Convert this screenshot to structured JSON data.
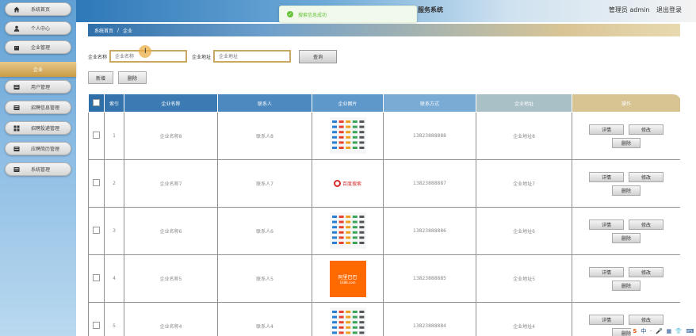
{
  "sidebar": {
    "items": [
      {
        "label": "系统首页",
        "icon": "home-icon"
      },
      {
        "label": "个人中心",
        "icon": "user-icon"
      },
      {
        "label": "企业管理",
        "icon": "building-icon"
      },
      {
        "label": "企业",
        "icon": ""
      },
      {
        "label": "用户管理",
        "icon": "list-icon"
      },
      {
        "label": "招聘信息管理",
        "icon": "list-icon"
      },
      {
        "label": "招聘投递管理",
        "icon": "grid-icon"
      },
      {
        "label": "应聘简历管理",
        "icon": "list-icon"
      },
      {
        "label": "系统管理",
        "icon": "list-icon"
      }
    ]
  },
  "header": {
    "system_title": "服务系统",
    "user_label": "管理员 admin",
    "logout_label": "退出登录"
  },
  "toast": {
    "message": "搜索信息成功"
  },
  "breadcrumb": {
    "home": "系统首页",
    "separator": "/",
    "current": "企业"
  },
  "search": {
    "company_name_label": "企业名称",
    "company_name_placeholder": "企业名称",
    "company_addr_label": "企业地址",
    "company_addr_placeholder": "企业地址",
    "search_button": "查询"
  },
  "actions": {
    "add": "新增",
    "delete": "删除"
  },
  "table": {
    "columns": [
      "",
      "索引",
      "企业名称",
      "联系人",
      "企业图片",
      "联系方式",
      "企业地址",
      "操作"
    ],
    "rows": [
      {
        "index": "1",
        "name": "企业名称8",
        "contact": "联系人8",
        "image": "logo-grid",
        "phone": "13823888888",
        "address": "企业地址8"
      },
      {
        "index": "2",
        "name": "企业名称7",
        "contact": "联系人7",
        "image": "logo-red",
        "phone": "13823888887",
        "address": "企业地址7"
      },
      {
        "index": "3",
        "name": "企业名称6",
        "contact": "联系人6",
        "image": "logo-grid",
        "phone": "13823888886",
        "address": "企业地址6"
      },
      {
        "index": "4",
        "name": "企业名称5",
        "contact": "联系人5",
        "image": "logo-alibaba",
        "phone": "13823888885",
        "address": "企业地址5"
      },
      {
        "index": "5",
        "name": "企业名称4",
        "contact": "联系人4",
        "image": "logo-grid",
        "phone": "13823888884",
        "address": "企业地址4"
      }
    ],
    "op_labels": {
      "detail": "详情",
      "edit": "修改",
      "delete": "删除"
    },
    "logo_red_text": "百度搜索",
    "logo_alibaba_text": "阿里巴巴",
    "logo_alibaba_sub": "1688.com"
  },
  "tray": {
    "items": [
      "S",
      "中",
      "·",
      "🎤",
      "▦",
      "👕",
      "⌨"
    ]
  },
  "colors": {
    "accent_gold": "#c9a865",
    "header_blue": "#2e78b8",
    "toast_green": "#67c23a"
  }
}
